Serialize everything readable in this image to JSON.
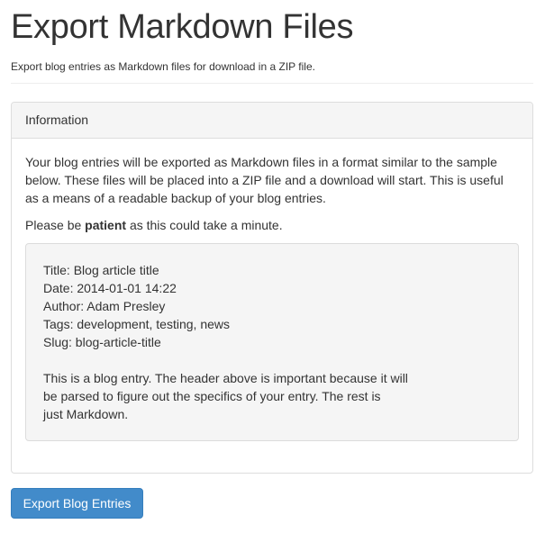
{
  "header": {
    "title": "Export Markdown Files",
    "subtitle": "Export blog entries as Markdown files for download in a ZIP file."
  },
  "panel": {
    "heading": "Information",
    "intro": "Your blog entries will be exported as Markdown files in a format similar to the sample below. These files will be placed into a ZIP file and a download will start. This is useful as a means of a readable backup of your blog entries.",
    "wait_prefix": "Please be ",
    "wait_emphasis": "patient",
    "wait_suffix": " as this could take a minute.",
    "sample": {
      "meta_lines": [
        "Title: Blog article title",
        "Date: 2014-01-01 14:22",
        "Author: Adam Presley",
        "Tags: development, testing, news",
        "Slug: blog-article-title"
      ],
      "body_lines": [
        "This is a blog entry. The header above is important because it will",
        "be parsed to figure out the specifics of your entry. The rest is",
        "just Markdown."
      ]
    }
  },
  "actions": {
    "export_label": "Export Blog Entries"
  },
  "colors": {
    "primary_button": "#428bca",
    "panel_heading_bg": "#f5f5f5",
    "text": "#333333"
  }
}
